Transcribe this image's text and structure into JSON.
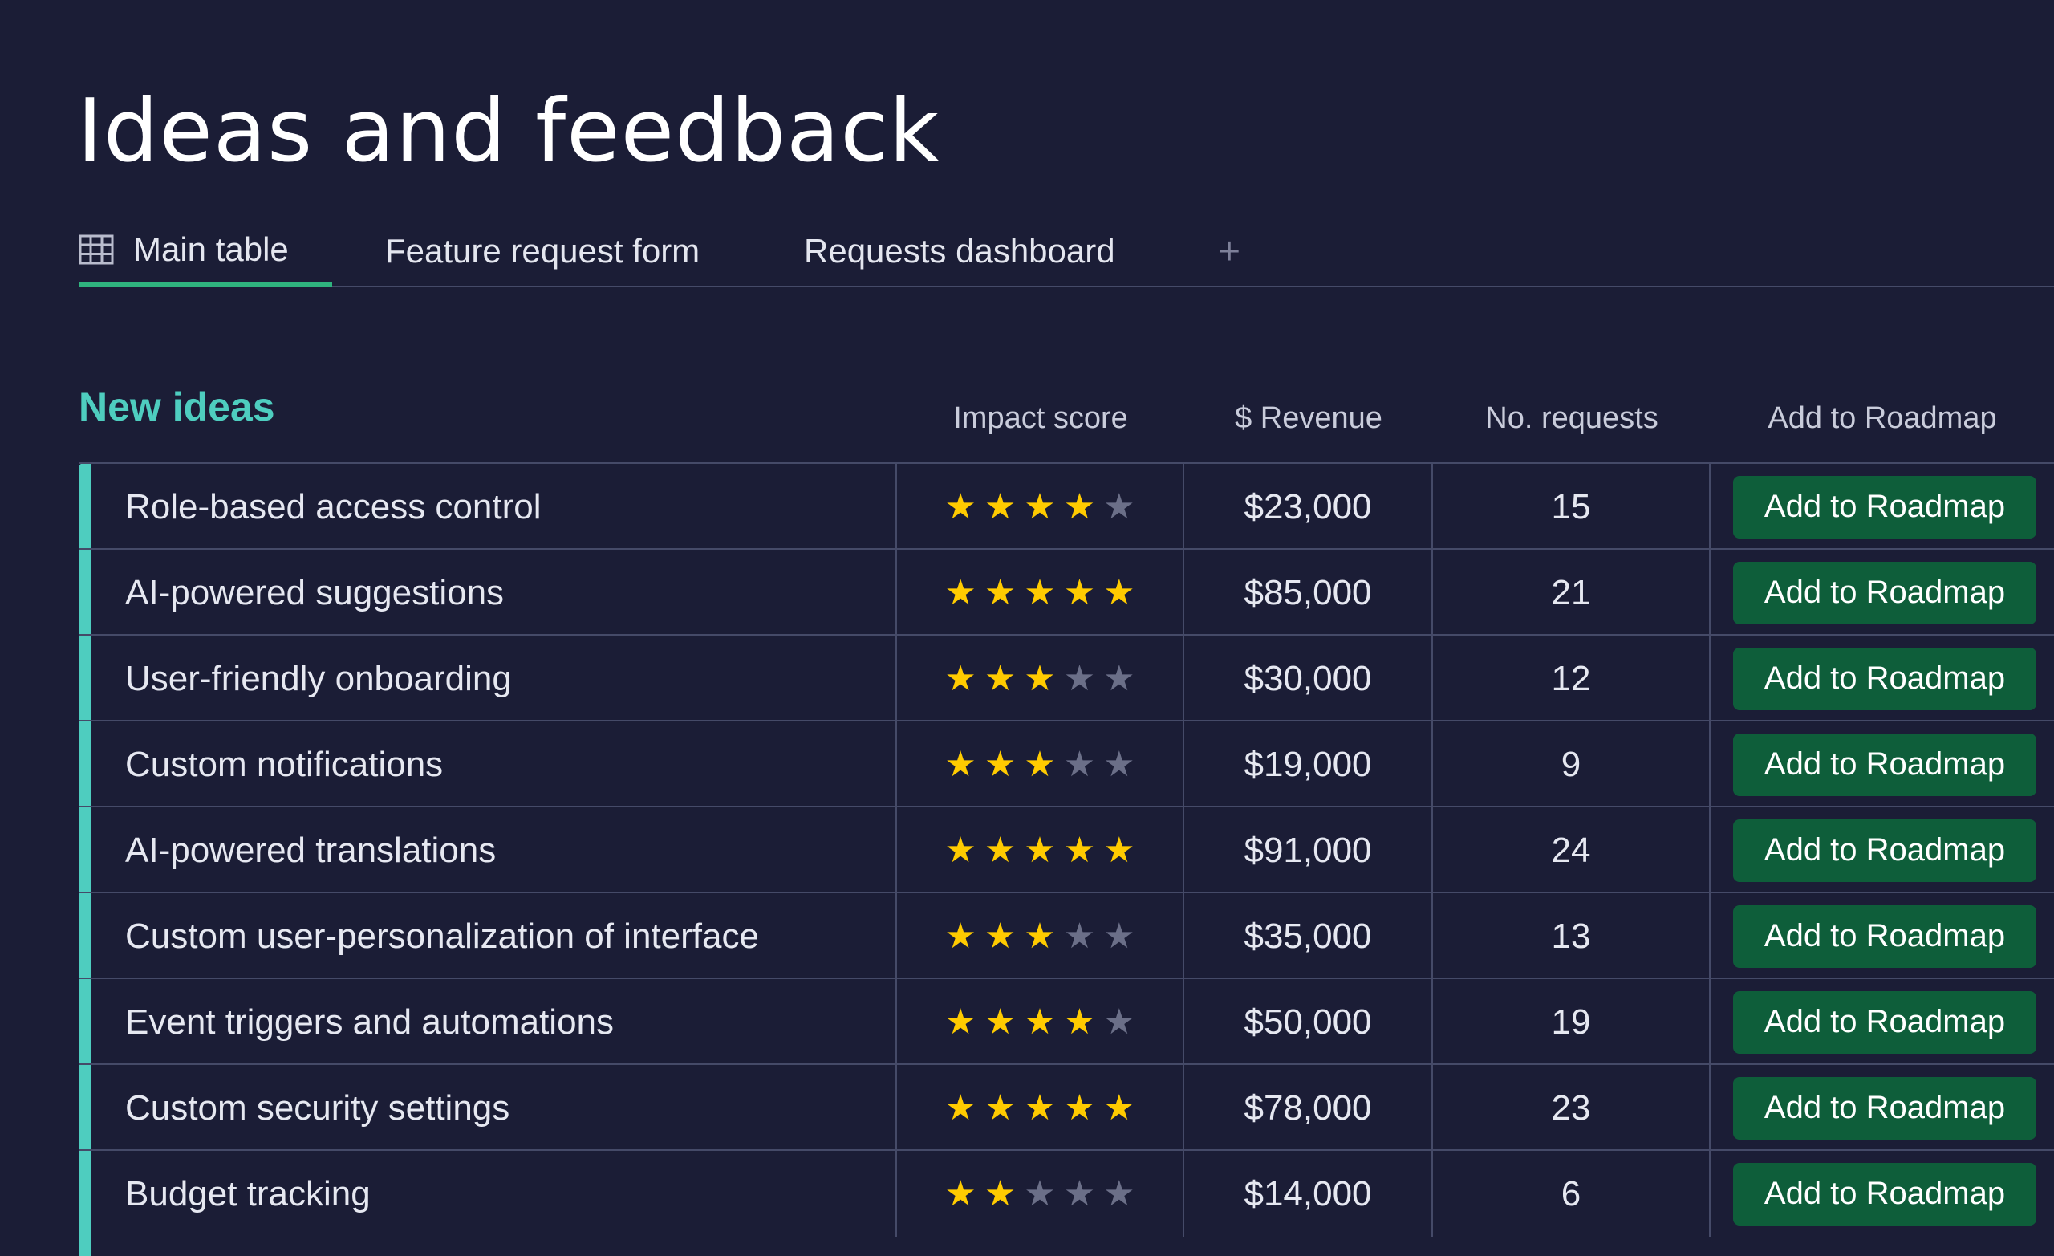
{
  "page": {
    "title": "Ideas and feedback"
  },
  "tabs": [
    {
      "label": "Main table",
      "icon": "table-icon",
      "active": true
    },
    {
      "label": "Feature request form",
      "active": false
    },
    {
      "label": "Requests dashboard",
      "active": false
    }
  ],
  "add_tab_label": "+",
  "group": {
    "title": "New ideas",
    "color": "#4ecdbf"
  },
  "columns": {
    "impact": "Impact score",
    "revenue": "$ Revenue",
    "requests": "No. requests",
    "roadmap": "Add to Roadmap"
  },
  "rows": [
    {
      "name": "Role-based access control",
      "stars": 4,
      "revenue": "$23,000",
      "requests": "15",
      "button": "Add to Roadmap"
    },
    {
      "name": "AI-powered suggestions",
      "stars": 5,
      "revenue": "$85,000",
      "requests": "21",
      "button": "Add to Roadmap"
    },
    {
      "name": "User-friendly onboarding",
      "stars": 3,
      "revenue": "$30,000",
      "requests": "12",
      "button": "Add to Roadmap"
    },
    {
      "name": "Custom notifications",
      "stars": 3,
      "revenue": "$19,000",
      "requests": "9",
      "button": "Add to Roadmap"
    },
    {
      "name": "AI-powered translations",
      "stars": 5,
      "revenue": "$91,000",
      "requests": "24",
      "button": "Add to Roadmap"
    },
    {
      "name": "Custom user-personalization of interface",
      "stars": 3,
      "revenue": "$35,000",
      "requests": "13",
      "button": "Add to Roadmap"
    },
    {
      "name": "Event triggers and automations",
      "stars": 4,
      "revenue": "$50,000",
      "requests": "19",
      "button": "Add to Roadmap"
    },
    {
      "name": "Custom security settings",
      "stars": 5,
      "revenue": "$78,000",
      "requests": "23",
      "button": "Add to Roadmap"
    },
    {
      "name": "Budget tracking",
      "stars": 2,
      "revenue": "$14,000",
      "requests": "6",
      "button": "Add to Roadmap"
    }
  ],
  "colors": {
    "background": "#1b1d36",
    "accent": "#4ecdbf",
    "active_tab": "#2fb37e",
    "star_on": "#ffcb00",
    "star_off": "#6b6f88",
    "button": "#0e5e3a"
  }
}
